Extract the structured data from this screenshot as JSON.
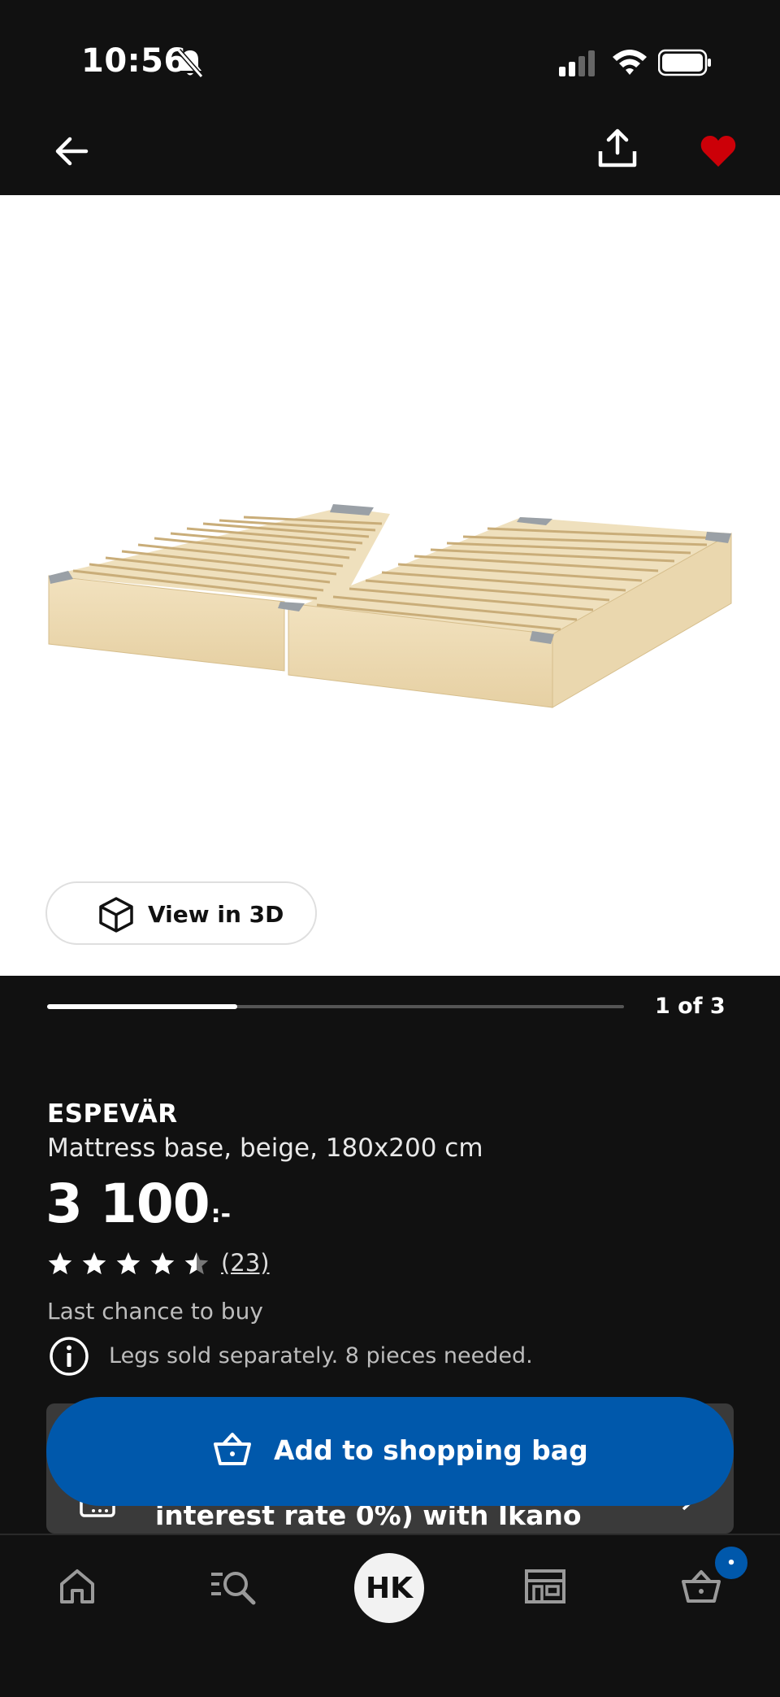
{
  "status_bar": {
    "time": "10:56"
  },
  "product": {
    "name": "ESPEVÄR",
    "description": "Mattress base, beige, 180x200 cm",
    "price": "3 100",
    "price_suffix": ":-",
    "rating": 4.5,
    "rating_max": 5,
    "reviews_label": "(23)",
    "availability": "Last chance to buy",
    "note": "Legs sold separately. 8 pieces needed."
  },
  "gallery": {
    "view_3d_label": "View in 3D",
    "counter": "1 of 3",
    "progress": 0.33
  },
  "financing": {
    "text": "interest rate 0%) with Ikano"
  },
  "cta": {
    "add_label": "Add to shopping bag"
  },
  "bottom_nav": {
    "profile_initials": "HK",
    "cart_badge": "•"
  },
  "icons": {
    "back": "arrow-left-icon",
    "share": "share-icon",
    "favorite": "heart-icon",
    "cube": "cube-icon",
    "info": "info-icon",
    "bag": "shopping-bag-icon",
    "home": "home-icon",
    "search": "search-icon",
    "store": "store-icon",
    "cart": "cart-icon"
  },
  "colors": {
    "brand_blue": "#0058ab",
    "favorite_red": "#cc0008",
    "background": "#111111"
  }
}
